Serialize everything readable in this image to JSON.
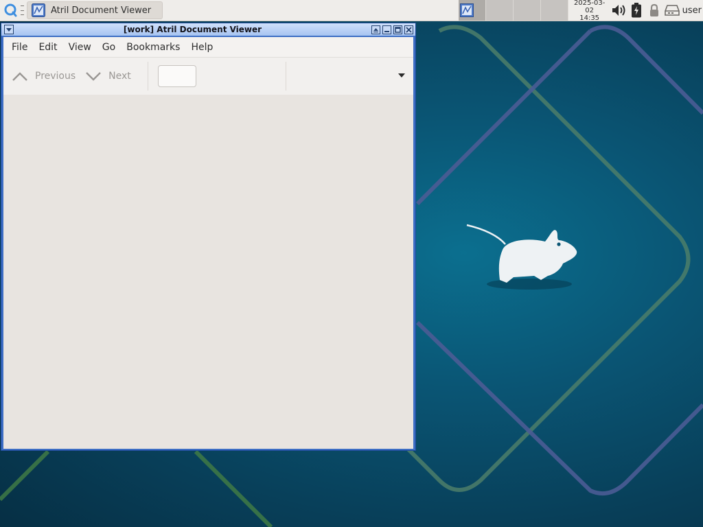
{
  "panel": {
    "taskbar_button_label": "Atril Document Viewer",
    "clock_date": "2025-03-02",
    "clock_time": "14:35",
    "user_label": "user"
  },
  "window": {
    "title": "[work] Atril Document Viewer",
    "menu": [
      "File",
      "Edit",
      "View",
      "Go",
      "Bookmarks",
      "Help"
    ],
    "toolbar": {
      "previous_label": "Previous",
      "next_label": "Next",
      "page_entry_value": ""
    }
  },
  "colors": {
    "titlebar_border": "#3c6dc4",
    "panel_bg": "#efedea",
    "desktop_bg": "#0a5574"
  }
}
